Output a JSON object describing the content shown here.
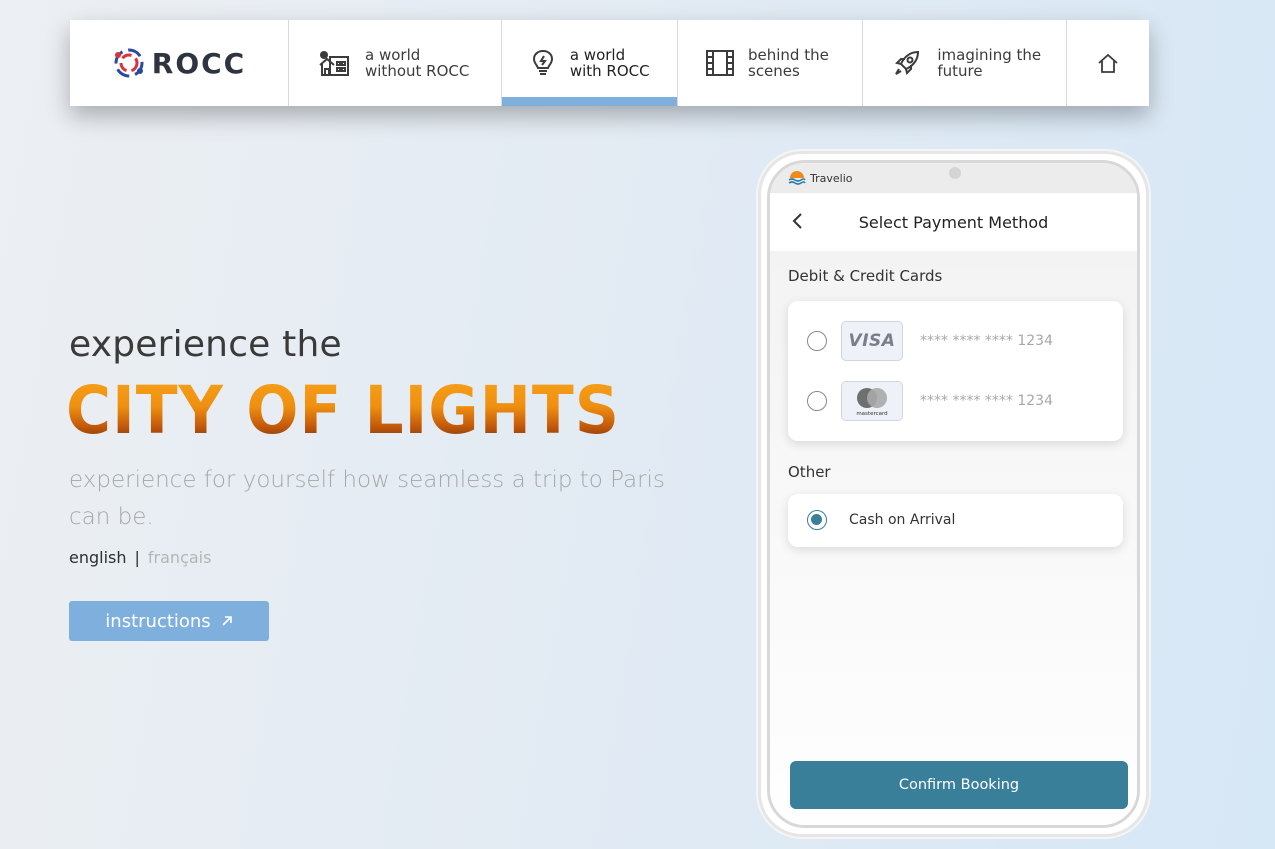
{
  "nav": {
    "brand": "ROCC",
    "items": [
      {
        "line1": "a world",
        "line2": "without ROCC",
        "icon": "house-question-icon",
        "active": false
      },
      {
        "line1": "a world",
        "line2": "with ROCC",
        "icon": "lightbulb-icon",
        "active": true
      },
      {
        "line1": "behind the",
        "line2": "scenes",
        "icon": "film-icon",
        "active": false
      },
      {
        "line1": "imagining the",
        "line2": "future",
        "icon": "rocket-icon",
        "active": false
      }
    ],
    "home_icon": "home-icon",
    "active_color": "#7fb0dd"
  },
  "hero": {
    "subtitle": "experience the",
    "title": "CITY OF LIGHTS",
    "description": "experience for yourself how seamless a trip to Paris can be.",
    "lang_english": "english",
    "lang_separator": "|",
    "lang_french": "français",
    "instructions_label": "instructions",
    "accent_color": "#7fb0dd"
  },
  "phone": {
    "app_name": "Travelio",
    "header_title": "Select Payment Method",
    "debit_label": "Debit & Credit Cards",
    "cards": [
      {
        "brand": "VISA",
        "number": "**** **** **** 1234",
        "selected": false
      },
      {
        "brand": "mastercard",
        "number": "**** **** **** 1234",
        "selected": false
      }
    ],
    "other_label": "Other",
    "cash_label": "Cash on Arrival",
    "cash_selected": true,
    "confirm_label": "Confirm Booking",
    "primary_color": "#3a7f99"
  }
}
